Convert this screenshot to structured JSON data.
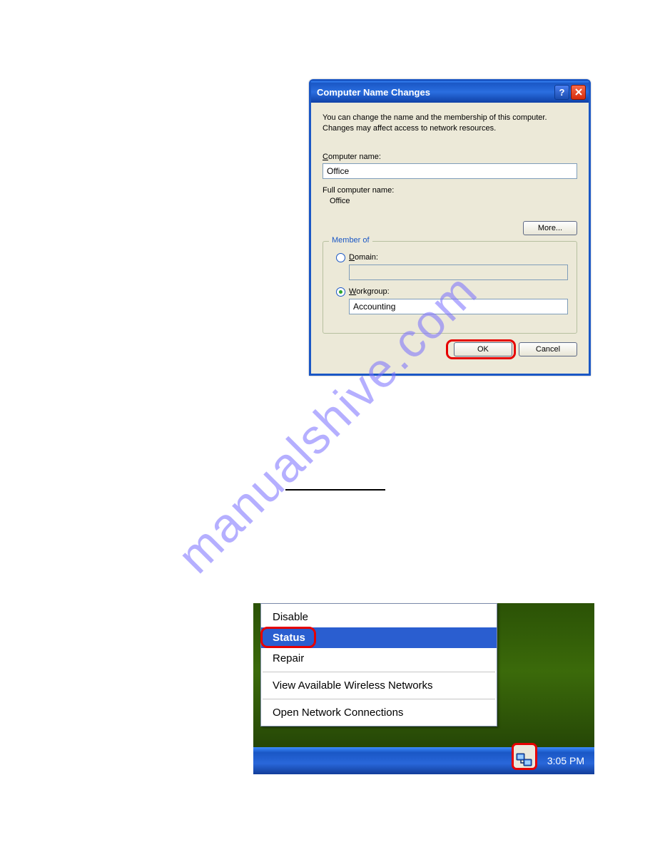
{
  "watermark": "manualshive.com",
  "dialog": {
    "title": "Computer Name Changes",
    "description": "You can change the name and the membership of this computer. Changes may affect access to network resources.",
    "computer_name_label": "Computer name:",
    "computer_name_value": "Office",
    "full_name_label": "Full computer name:",
    "full_name_value": "Office",
    "more_button": "More...",
    "group_legend": "Member of",
    "domain_label": "Domain:",
    "domain_value": "",
    "workgroup_label": "Workgroup:",
    "workgroup_value": "Accounting",
    "ok_button": "OK",
    "cancel_button": "Cancel"
  },
  "context_menu": {
    "items": [
      "Disable",
      "Status",
      "Repair",
      "View Available Wireless Networks",
      "Open Network Connections"
    ],
    "selected_index": 1
  },
  "taskbar": {
    "clock": "3:05 PM"
  }
}
